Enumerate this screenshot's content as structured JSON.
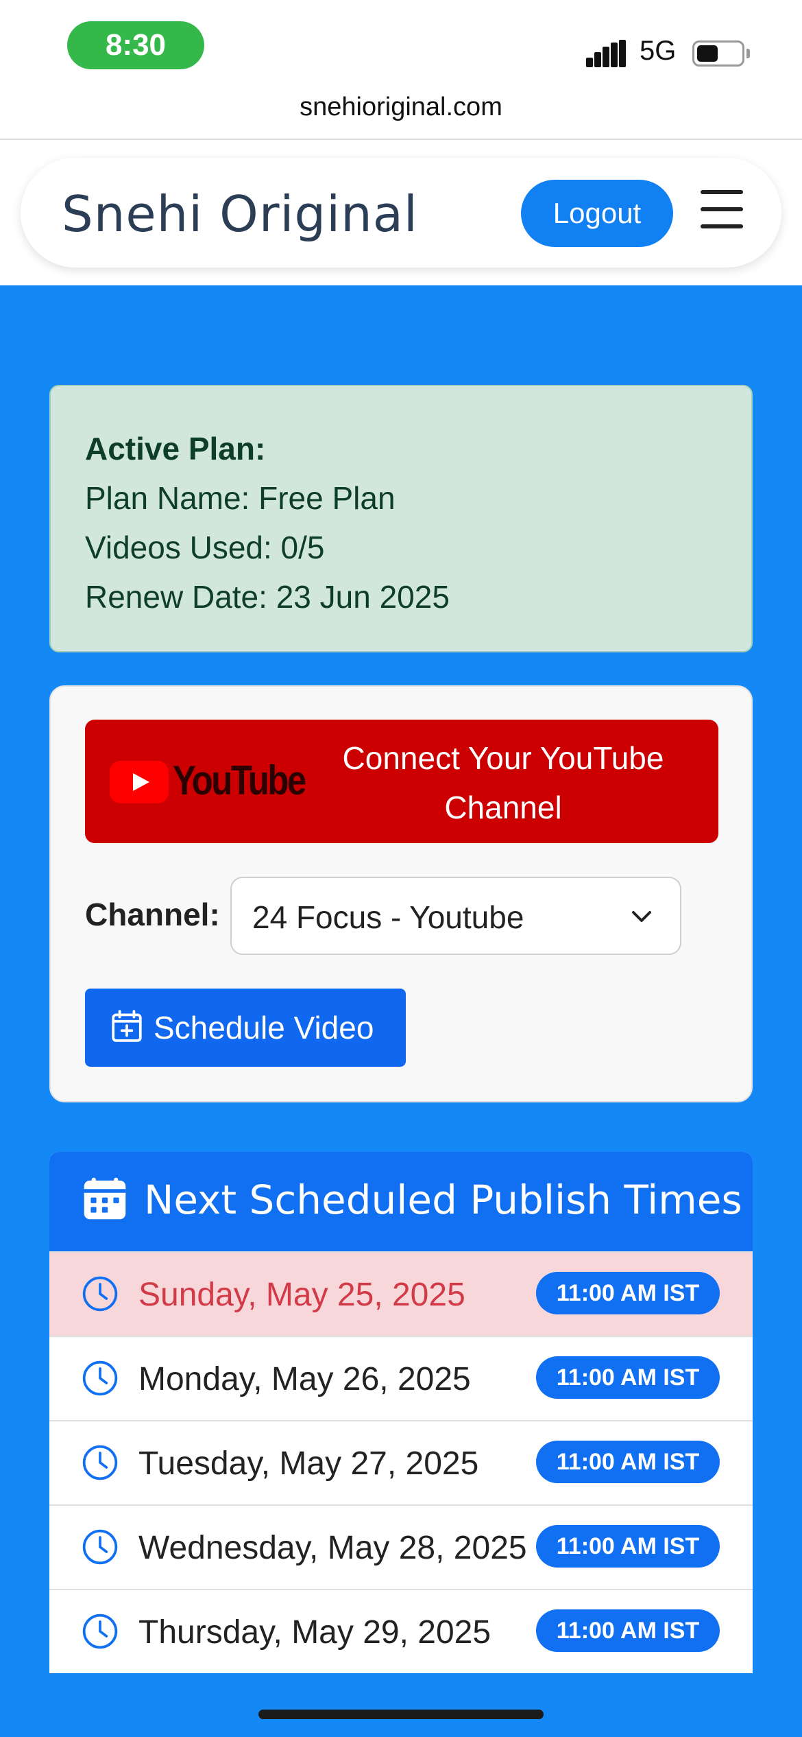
{
  "status_bar": {
    "time": "8:30",
    "network": "5G"
  },
  "browser": {
    "url": "snehioriginal.com"
  },
  "navbar": {
    "brand": "Snehi Original",
    "logout_label": "Logout"
  },
  "plan": {
    "heading": "Active Plan:",
    "name": "Plan Name: Free Plan",
    "videos_used": "Videos Used: 0/5",
    "renew_date": "Renew Date: 23 Jun 2025"
  },
  "youtube": {
    "logo_text": "YouTube",
    "connect_label": "Connect Your YouTube Channel",
    "channel_label": "Channel:",
    "channel_selected": "24 Focus - Youtube",
    "schedule_label": "Schedule Video"
  },
  "schedule": {
    "title": "Next Scheduled Publish Times",
    "rows": [
      {
        "date": "Sunday, May 25, 2025",
        "time": "11:00 AM IST",
        "highlight": true
      },
      {
        "date": "Monday, May 26, 2025",
        "time": "11:00 AM IST"
      },
      {
        "date": "Tuesday, May 27, 2025",
        "time": "11:00 AM IST"
      },
      {
        "date": "Wednesday, May 28, 2025",
        "time": "11:00 AM IST"
      },
      {
        "date": "Thursday, May 29, 2025",
        "time": "11:00 AM IST"
      }
    ]
  },
  "colors": {
    "primary": "#1170f2",
    "page_background": "#1489f5",
    "youtube_red": "#cc0000",
    "plan_background": "#d1e7dd",
    "highlight_row": "#f8d7da"
  }
}
